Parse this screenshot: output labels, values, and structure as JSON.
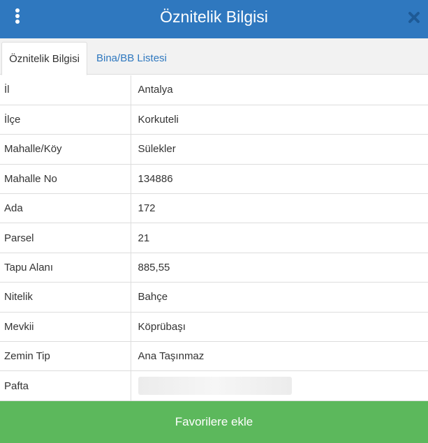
{
  "header": {
    "title": "Öznitelik Bilgisi",
    "menu_icon": "kebab-menu-icon",
    "close_icon": "close-icon",
    "background_color": "#2f78bf"
  },
  "tabs": [
    {
      "label": "Öznitelik Bilgisi",
      "active": true
    },
    {
      "label": "Bina/BB Listesi",
      "active": false
    }
  ],
  "attributes": [
    {
      "key": "İl",
      "value": "Antalya"
    },
    {
      "key": "İlçe",
      "value": "Korkuteli"
    },
    {
      "key": "Mahalle/Köy",
      "value": "Sülekler"
    },
    {
      "key": "Mahalle No",
      "value": "134886"
    },
    {
      "key": "Ada",
      "value": "172"
    },
    {
      "key": "Parsel",
      "value": "21"
    },
    {
      "key": "Tapu Alanı",
      "value": "885,55"
    },
    {
      "key": "Nitelik",
      "value": "Bahçe"
    },
    {
      "key": "Mevkii",
      "value": "Köprübaşı"
    },
    {
      "key": "Zemin Tip",
      "value": "Ana Taşınmaz"
    },
    {
      "key": "Pafta",
      "value": ""
    }
  ],
  "footer": {
    "button_label": "Favorilere ekle",
    "button_color": "#5cb85c"
  }
}
